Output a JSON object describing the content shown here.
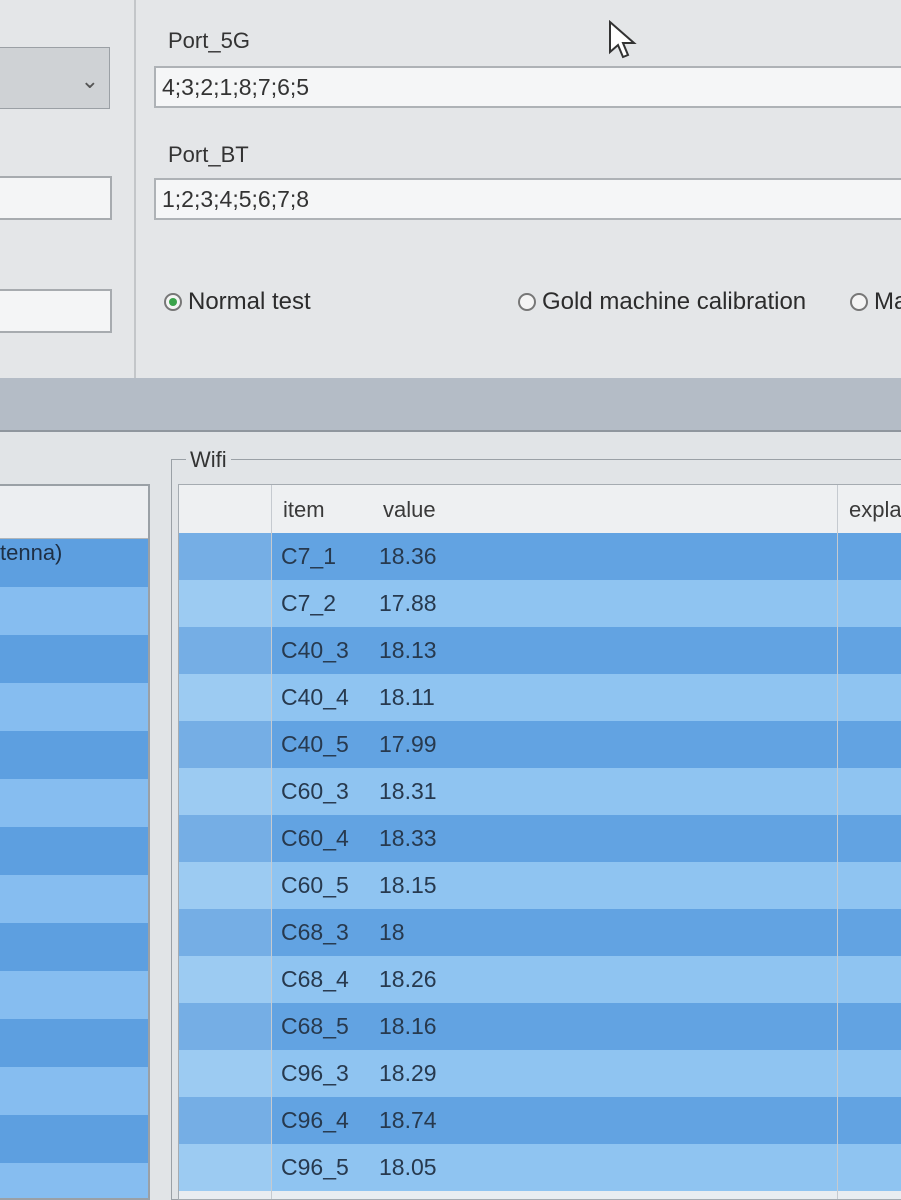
{
  "config": {
    "port_5g": {
      "label": "Port_5G",
      "value": "4;3;2;1;8;7;6;5"
    },
    "port_bt": {
      "label": "Port_BT",
      "value": "1;2;3;4;5;6;7;8"
    },
    "modes": [
      {
        "label": "Normal test",
        "selected": true
      },
      {
        "label": "Gold machine calibration",
        "selected": false
      },
      {
        "label": "Ma",
        "selected": false
      }
    ]
  },
  "left_panel": {
    "row_label": "tenna)"
  },
  "wifi": {
    "group_title": "Wifi",
    "columns": {
      "item": "item",
      "value": "value",
      "explain": "expla"
    },
    "rows": [
      {
        "item": "C7_1",
        "value": "18.36"
      },
      {
        "item": "C7_2",
        "value": "17.88"
      },
      {
        "item": "C40_3",
        "value": "18.13"
      },
      {
        "item": "C40_4",
        "value": "18.11"
      },
      {
        "item": "C40_5",
        "value": "17.99"
      },
      {
        "item": "C60_3",
        "value": "18.31"
      },
      {
        "item": "C60_4",
        "value": "18.33"
      },
      {
        "item": "C60_5",
        "value": "18.15"
      },
      {
        "item": "C68_3",
        "value": "18"
      },
      {
        "item": "C68_4",
        "value": "18.26"
      },
      {
        "item": "C68_5",
        "value": "18.16"
      },
      {
        "item": "C96_3",
        "value": "18.29"
      },
      {
        "item": "C96_4",
        "value": "18.74"
      },
      {
        "item": "C96_5",
        "value": "18.05"
      }
    ]
  },
  "colors": {
    "row_dark": "#62a3e2",
    "row_light": "#8fc4f1",
    "radio_selected": "#3aa34a"
  }
}
